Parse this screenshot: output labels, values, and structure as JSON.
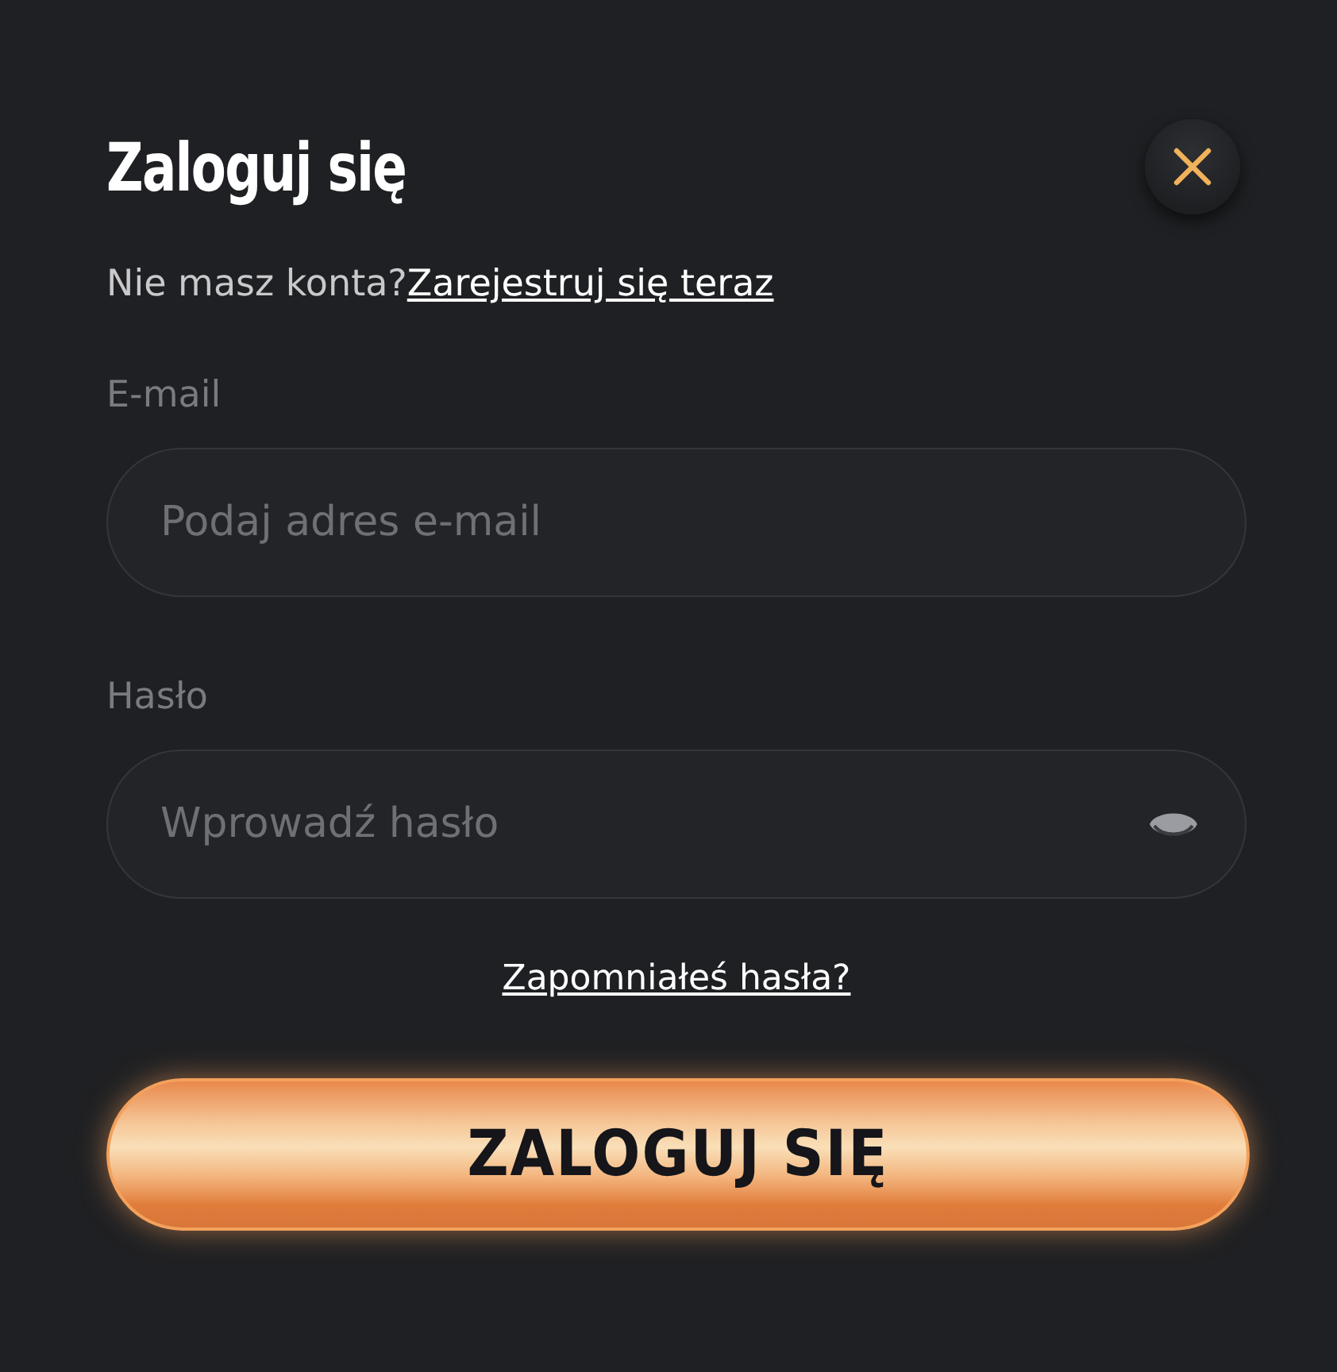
{
  "dialog": {
    "title": "Zaloguj się"
  },
  "register": {
    "prompt": "Nie masz konta?",
    "link": "Zarejestruj się teraz"
  },
  "fields": [
    {
      "kind": "email",
      "label": "E-mail",
      "placeholder": "Podaj adres e-mail"
    },
    {
      "kind": "password",
      "label": "Hasło",
      "placeholder": "Wprowadź hasło"
    }
  ],
  "forgot_link": "Zapomniałeś hasła?",
  "submit_button": "ZALOGUJ SIĘ"
}
